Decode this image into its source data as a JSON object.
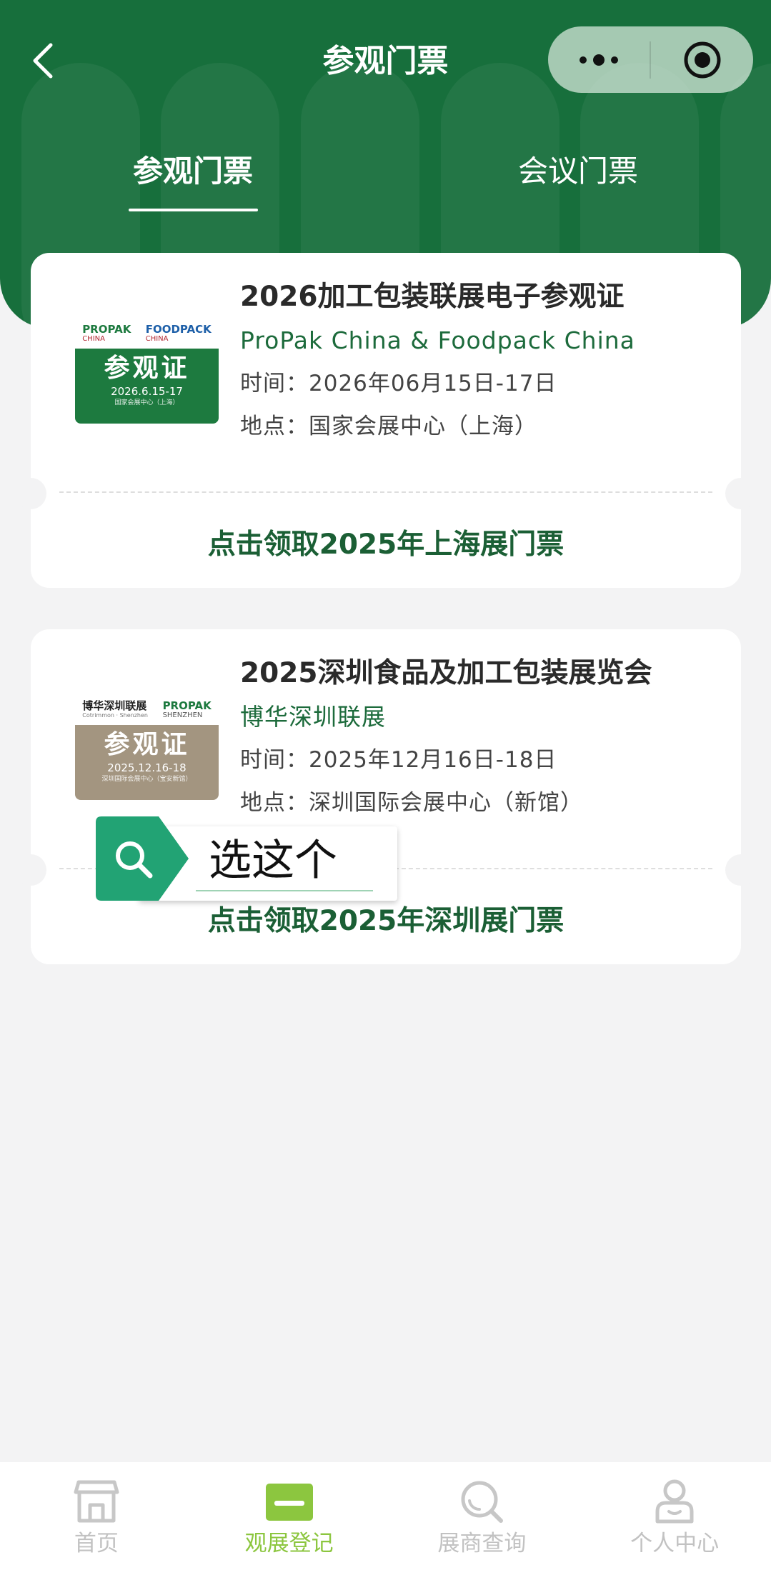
{
  "header": {
    "title": "参观门票",
    "back_icon": "chevron-left-icon",
    "capsule": {
      "more_icon": "more-dots-icon",
      "close_icon": "target-icon"
    },
    "colors": {
      "primary": "#176f3c",
      "accent": "#1d6b3c"
    }
  },
  "tabs": [
    {
      "label": "参观门票",
      "active": true
    },
    {
      "label": "会议门票",
      "active": false
    }
  ],
  "tickets": [
    {
      "thumb": {
        "brand_left": "PROPAK",
        "brand_left_sub": "CHINA",
        "brand_right": "FOODPACK",
        "brand_right_sub": "CHINA",
        "title": "参观证",
        "date": "2026.6.15-17",
        "venue": "国家会展中心（上海）",
        "bg": "#1d7a3f"
      },
      "title": "2026加工包装联展电子参观证",
      "subtitle": "ProPak China & Foodpack China",
      "time": "时间：2026年06月15日-17日",
      "location": "地点：国家会展中心（上海）",
      "action": "点击领取2025年上海展门票"
    },
    {
      "thumb": {
        "brand_left": "博华深圳联展",
        "brand_left_sub": "Cotrimmon · Shenzhen",
        "brand_right": "PROPAK",
        "brand_right_sub": "SHENZHEN",
        "title": "参观证",
        "date": "2025.12.16-18",
        "venue": "深圳国际会展中心（宝安新馆）",
        "bg": "#a39580"
      },
      "title": "2025深圳食品及加工包装展览会",
      "subtitle": "博华深圳联展",
      "time": "时间：2025年12月16日-18日",
      "location": "地点：深圳国际会展中心（新馆）",
      "action": "点击领取2025年深圳展门票"
    }
  ],
  "search_tip": {
    "label": "选这个",
    "icon": "search-icon"
  },
  "bottom_nav": [
    {
      "label": "首页",
      "icon": "store-icon",
      "active": false
    },
    {
      "label": "观展登记",
      "icon": "ticket-icon",
      "active": true
    },
    {
      "label": "展商查询",
      "icon": "search-icon",
      "active": false
    },
    {
      "label": "个人中心",
      "icon": "user-icon",
      "active": false
    }
  ]
}
